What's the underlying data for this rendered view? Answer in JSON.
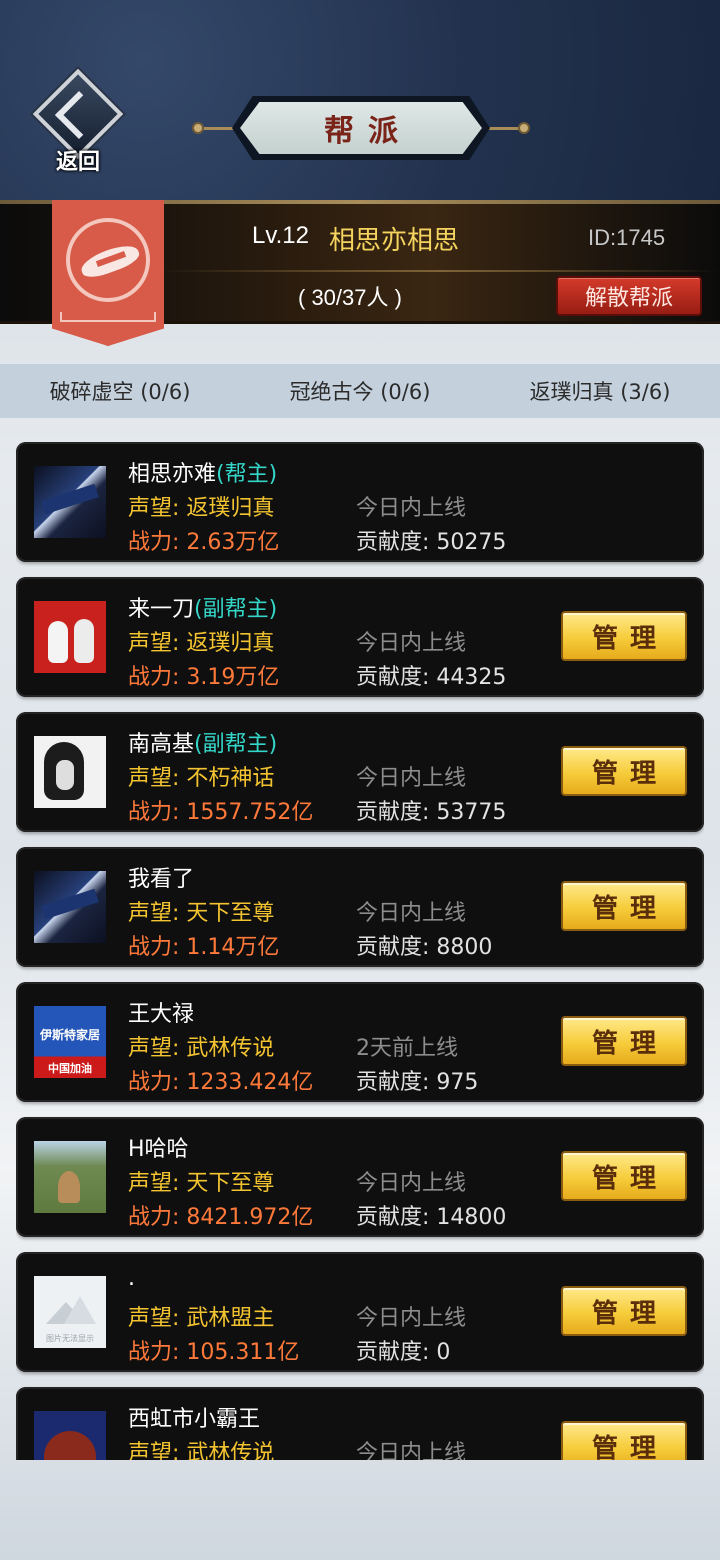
{
  "header": {
    "back_label": "返回",
    "title": "帮派"
  },
  "guild": {
    "level": "Lv.12",
    "name": "相思亦相思",
    "id": "ID:1745",
    "member_count": "( 30/37人 )",
    "disband_label": "解散帮派"
  },
  "stats": [
    {
      "label": "破碎虚空 (0/6)"
    },
    {
      "label": "冠绝古今 (0/6)"
    },
    {
      "label": "返璞归真 (3/6)"
    }
  ],
  "members": [
    {
      "name": "相思亦难",
      "role": "(帮主)",
      "reputation": "声望: 返璞归真",
      "power": "战力: 2.63万亿",
      "online": "今日内上线",
      "contribution": "贡献度: 50275",
      "avatar": "ninja-avatar",
      "manage_label": ""
    },
    {
      "name": "来一刀",
      "role": "(副帮主)",
      "reputation": "声望: 返璞归真",
      "power": "战力: 3.19万亿",
      "online": "今日内上线",
      "contribution": "贡献度: 44325",
      "avatar": "snowman-avatar",
      "manage_label": "管理"
    },
    {
      "name": "南高基",
      "role": "(副帮主)",
      "reputation": "声望: 不朽神话",
      "power": "战力: 1557.752亿",
      "online": "今日内上线",
      "contribution": "贡献度: 53775",
      "avatar": "sketch-avatar",
      "manage_label": "管理"
    },
    {
      "name": "我看了",
      "role": "",
      "reputation": "声望: 天下至尊",
      "power": "战力: 1.14万亿",
      "online": "今日内上线",
      "contribution": "贡献度: 8800",
      "avatar": "ninja-avatar",
      "manage_label": "管理"
    },
    {
      "name": "王大禄",
      "role": "",
      "reputation": "声望: 武林传说",
      "power": "战力: 1233.424亿",
      "online": "2天前上线",
      "contribution": "贡献度: 975",
      "avatar": "ad-avatar",
      "avatar_text_top": "伊斯特家居",
      "avatar_text_bottom": "中国加油",
      "manage_label": "管理"
    },
    {
      "name": "H哈哈",
      "role": "",
      "reputation": "声望: 天下至尊",
      "power": "战力: 8421.972亿",
      "online": "今日内上线",
      "contribution": "贡献度: 14800",
      "avatar": "field-avatar",
      "manage_label": "管理"
    },
    {
      "name": ".",
      "role": "",
      "reputation": "声望: 武林盟主",
      "power": "战力: 105.311亿",
      "online": "今日内上线",
      "contribution": "贡献度: 0",
      "avatar": "placeholder-avatar",
      "avatar_caption": "图片无法显示",
      "manage_label": "管理"
    },
    {
      "name": "西虹市小霸王",
      "role": "",
      "reputation": "声望: 武林传说",
      "power": "",
      "online": "今日内上线",
      "contribution": "",
      "avatar": "mask-avatar",
      "manage_label": "管理"
    }
  ]
}
